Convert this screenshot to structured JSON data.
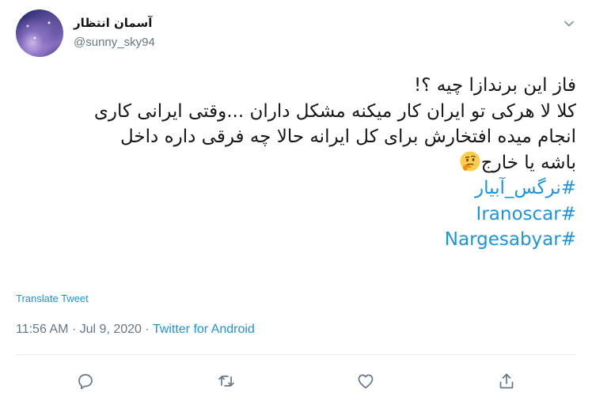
{
  "user": {
    "display_name": "آسمان انتظار",
    "handle": "@sunny_sky94"
  },
  "tweet": {
    "lines": [
      "فاز این برندازا چیه ؟!",
      "کلا لا هرکی تو ایران کار میکنه مشکل داران ...وقتی ایرانی کاری",
      "انجام میده افتخارش برای کل ایرانه حالا چه فرقی داره داخل",
      "باشه یا خارج"
    ],
    "hashtags": [
      "#نرگس_آبیار",
      "#Iranoscar",
      "#Nargesabyar"
    ]
  },
  "translate_label": "Translate Tweet",
  "meta": {
    "time": "11:56 AM",
    "date": "Jul 9, 2020",
    "source": "Twitter for Android",
    "separator": "·"
  },
  "icons": {
    "more": "chevron-down-icon",
    "emoji": "thinking-face-emoji",
    "actions": [
      "reply-icon",
      "retweet-icon",
      "like-icon",
      "share-icon"
    ]
  },
  "colors": {
    "link": "#1b95e0",
    "secondary_text": "#657786",
    "text": "#14171a",
    "divider": "#e6ecf0"
  }
}
